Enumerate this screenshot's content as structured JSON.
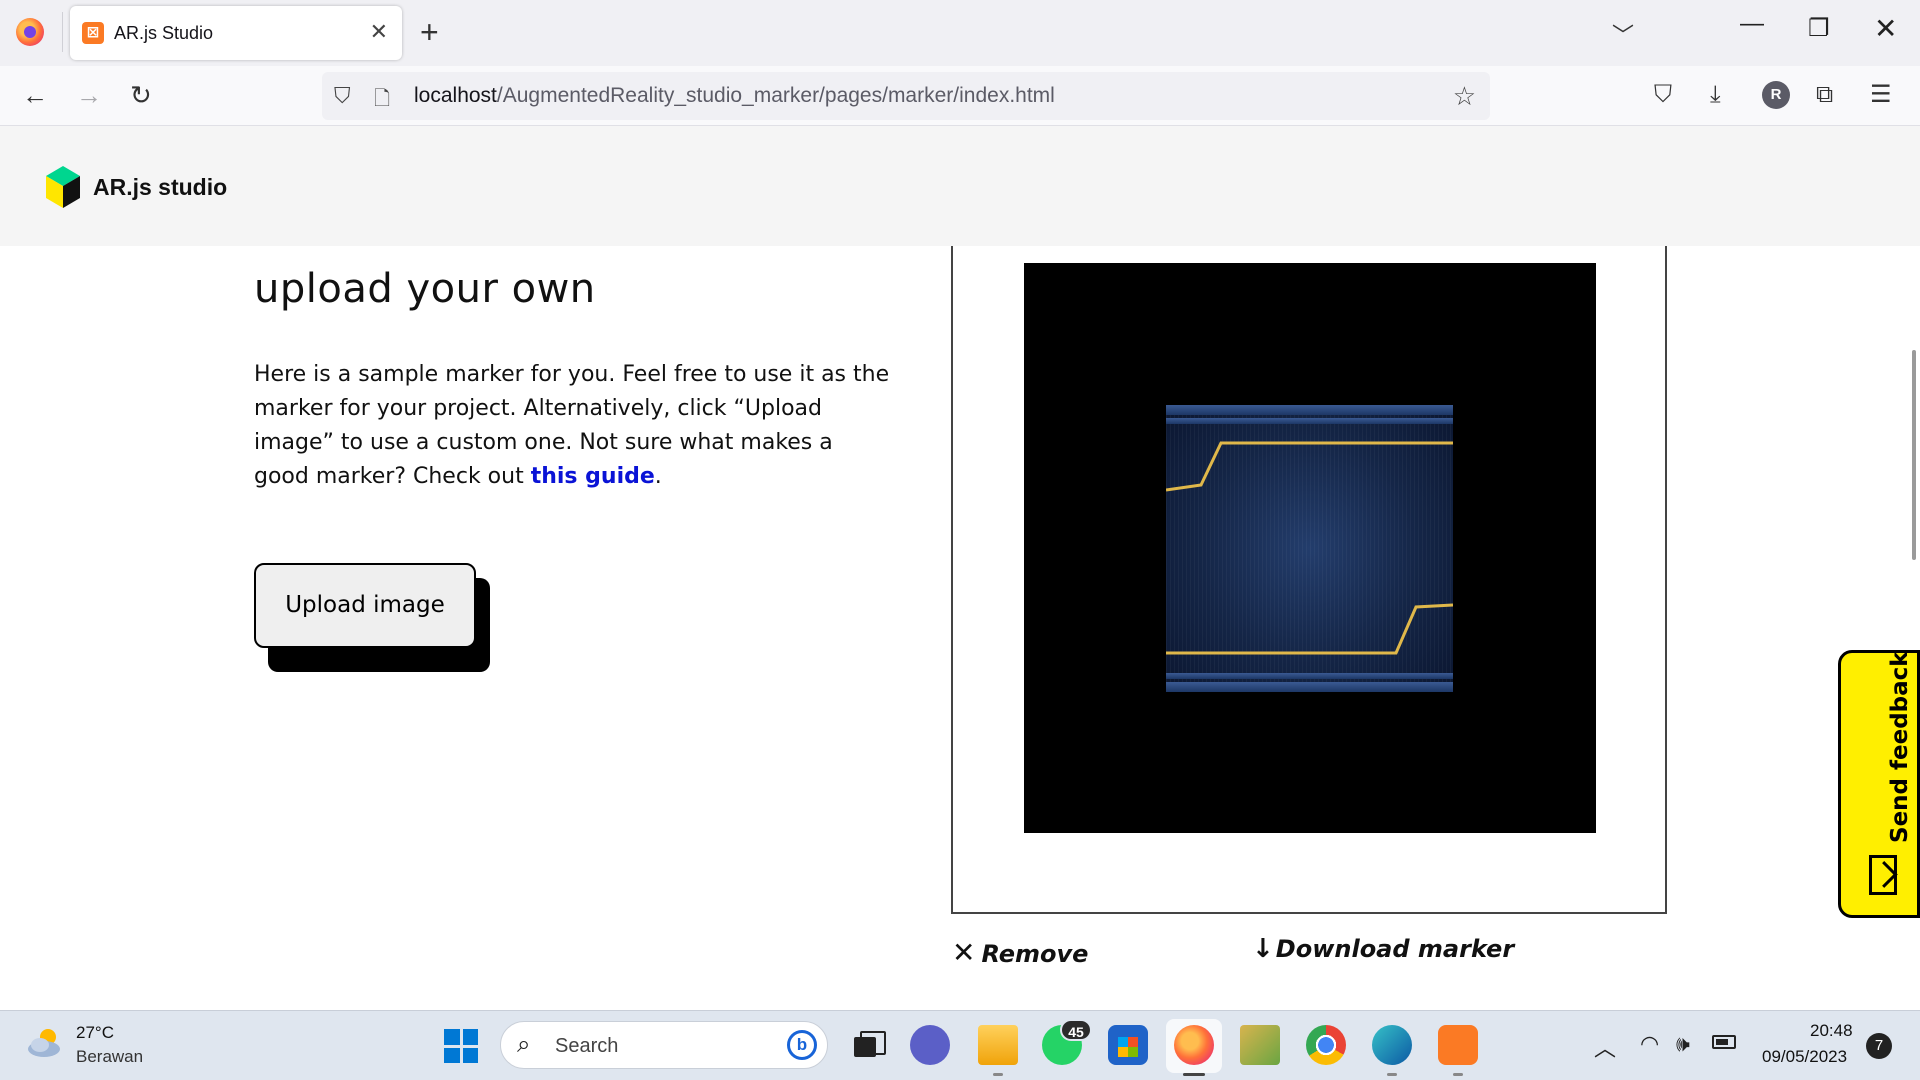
{
  "browser": {
    "tab_title": "AR.js Studio",
    "tab_close": "✕",
    "new_tab": "+",
    "url_host": "localhost",
    "url_path": "/AugmentedReality_studio_marker/pages/marker/index.html"
  },
  "header": {
    "brand": "AR.js studio"
  },
  "main": {
    "heading": "upload your own",
    "description_before_link": "Here is a sample marker for you. Feel free to use it as the marker for your project. Alternatively, click “Upload image” to use a custom one. Not sure what makes a good marker? Check out ",
    "guide_link": "this guide",
    "description_after_link": ".",
    "upload_button": "Upload image",
    "remove_link": "Remove",
    "download_link": "Download marker",
    "feedback": "Send feedback"
  },
  "taskbar": {
    "temperature": "27°C",
    "weather": "Berawan",
    "search_placeholder": "Search",
    "whatsapp_badge": "45",
    "time": "20:48",
    "date": "09/05/2023",
    "notifications": "7"
  },
  "colors": {
    "link": "#0a13d6",
    "feedback_bg": "#ffef00",
    "brand_green": "#00d68f"
  }
}
